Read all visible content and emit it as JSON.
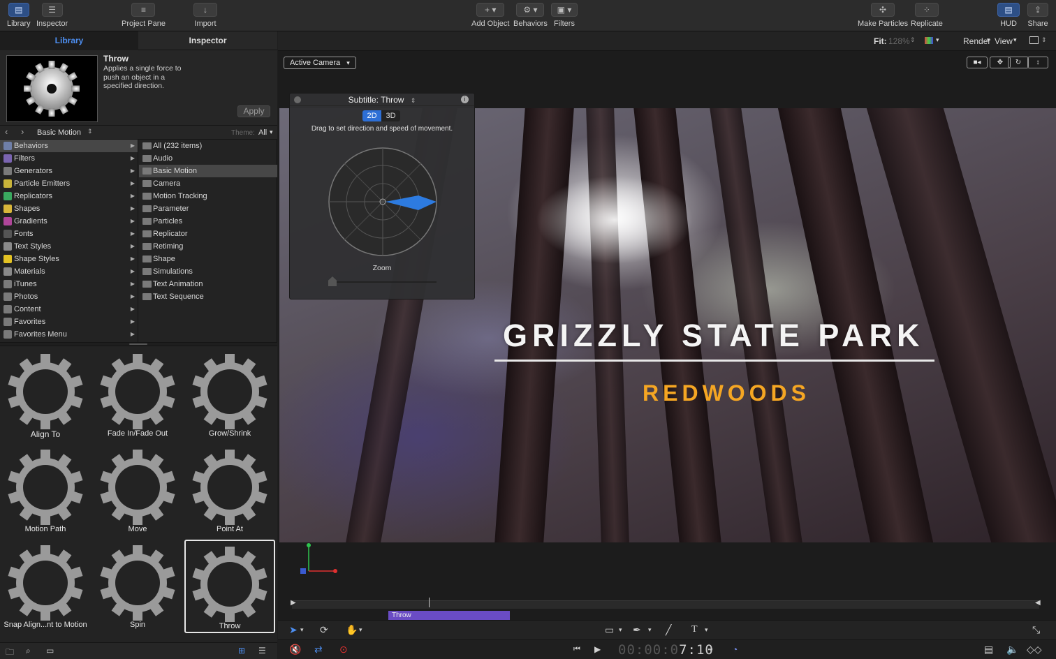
{
  "toolbar": {
    "library": "Library",
    "inspector": "Inspector",
    "project_pane": "Project Pane",
    "import": "Import",
    "add_object": "Add Object",
    "behaviors": "Behaviors",
    "filters": "Filters",
    "make_particles": "Make Particles",
    "replicate": "Replicate",
    "hud": "HUD",
    "share": "Share"
  },
  "panel_tabs": {
    "library": "Library",
    "inspector": "Inspector"
  },
  "preview": {
    "title": "Throw",
    "description": "Applies a single force to push an object in a specified direction.",
    "apply_label": "Apply"
  },
  "nav": {
    "back": "‹",
    "forward": "›",
    "folder": "Basic Motion",
    "theme_label": "Theme:",
    "theme_value": "All"
  },
  "categories": [
    {
      "label": "Behaviors",
      "selected": true,
      "color": "#6f7fa8"
    },
    {
      "label": "Filters",
      "color": "#7a64b0"
    },
    {
      "label": "Generators",
      "color": "#7a7a7a"
    },
    {
      "label": "Particle Emitters",
      "color": "#c8b33a"
    },
    {
      "label": "Replicators",
      "color": "#3aa85f"
    },
    {
      "label": "Shapes",
      "color": "#d8b63a"
    },
    {
      "label": "Gradients",
      "color": "#b0469a"
    },
    {
      "label": "Fonts",
      "color": "#555555"
    },
    {
      "label": "Text Styles",
      "color": "#8a8a8a"
    },
    {
      "label": "Shape Styles",
      "color": "#e3c223"
    },
    {
      "label": "Materials",
      "color": "#8a8a8a"
    },
    {
      "label": "iTunes",
      "color": "#7a7a7a"
    },
    {
      "label": "Photos",
      "color": "#7a7a7a"
    },
    {
      "label": "Content",
      "color": "#7a7a7a"
    },
    {
      "label": "Favorites",
      "color": "#7a7a7a"
    },
    {
      "label": "Favorites Menu",
      "color": "#7a7a7a"
    }
  ],
  "subcategories": [
    {
      "label": "All (232 items)"
    },
    {
      "label": "Audio"
    },
    {
      "label": "Basic Motion",
      "selected": true
    },
    {
      "label": "Camera"
    },
    {
      "label": "Motion Tracking"
    },
    {
      "label": "Parameter"
    },
    {
      "label": "Particles"
    },
    {
      "label": "Replicator"
    },
    {
      "label": "Retiming"
    },
    {
      "label": "Shape"
    },
    {
      "label": "Simulations"
    },
    {
      "label": "Text Animation"
    },
    {
      "label": "Text Sequence"
    }
  ],
  "behaviors_grid": [
    {
      "label": "Align To"
    },
    {
      "label": "Fade In/Fade Out"
    },
    {
      "label": "Grow/Shrink"
    },
    {
      "label": "Motion Path"
    },
    {
      "label": "Move"
    },
    {
      "label": "Point At"
    },
    {
      "label": "Snap Align...nt to Motion"
    },
    {
      "label": "Spin"
    },
    {
      "label": "Throw",
      "selected": true
    }
  ],
  "canvas_header": {
    "fit_label": "Fit:",
    "fit_value": "128%",
    "render": "Render",
    "view": "View"
  },
  "viewer": {
    "active_camera": "Active Camera"
  },
  "hud": {
    "title": "Subtitle: Throw",
    "seg_2d": "2D",
    "seg_3d": "3D",
    "description": "Drag to set direction and speed of movement.",
    "zoom_label": "Zoom"
  },
  "overlay_text": {
    "title": "GRIZZLY STATE PARK",
    "subtitle": "REDWOODS"
  },
  "timeline": {
    "clip_label": "Throw"
  },
  "transport": {
    "timecode_dim": "00:00:0",
    "timecode_hi": "7:10"
  },
  "colors": {
    "accent_blue": "#2d6fd6",
    "subtitle_orange": "#f5a623",
    "clip_purple": "#6a4cc4"
  }
}
